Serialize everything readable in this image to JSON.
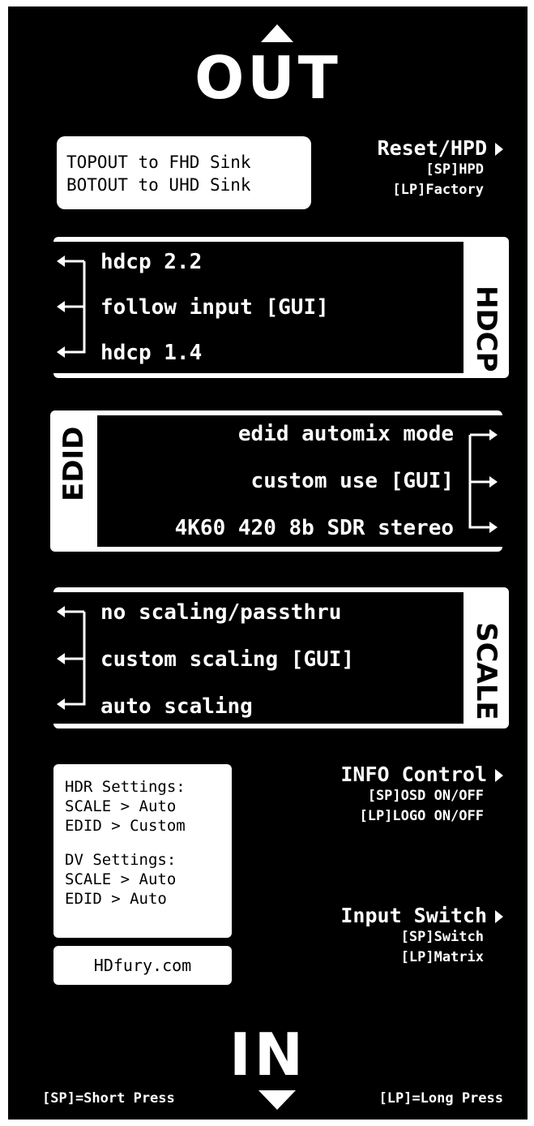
{
  "header": {
    "out_label": "OUT"
  },
  "info_box": {
    "line1": "TOPOUT to FHD Sink",
    "line2": "BOTOUT to UHD Sink"
  },
  "reset_button": {
    "label": "Reset/HPD",
    "short_press": "[SP]HPD",
    "long_press": "[LP]Factory"
  },
  "hdcp": {
    "title": "HDCP",
    "options": [
      "hdcp 2.2",
      "follow input [GUI]",
      "hdcp 1.4"
    ]
  },
  "edid": {
    "title": "EDID",
    "options": [
      "edid automix mode",
      "custom use [GUI]",
      "4K60 420 8b SDR stereo"
    ]
  },
  "scale": {
    "title": "SCALE",
    "options": [
      "no scaling/passthru",
      "custom scaling [GUI]",
      "auto scaling"
    ]
  },
  "settings_box": {
    "hdr_title": "HDR Settings:",
    "hdr_scale": "SCALE > Auto",
    "hdr_edid": "EDID > Custom",
    "dv_title": "DV Settings:",
    "dv_scale": "SCALE > Auto",
    "dv_edid": "EDID > Auto"
  },
  "website": "HDfury.com",
  "info_control": {
    "label": "INFO Control",
    "short_press": "[SP]OSD ON/OFF",
    "long_press": "[LP]LOGO ON/OFF"
  },
  "input_switch": {
    "label": "Input Switch",
    "short_press": "[SP]Switch",
    "long_press": "[LP]Matrix"
  },
  "footer": {
    "in_label": "IN",
    "sp_legend": "[SP]=Short Press",
    "lp_legend": "[LP]=Long Press"
  },
  "colors": {
    "background": "#000000",
    "foreground": "#ffffff"
  },
  "icons": [
    "arrow-up-icon",
    "arrow-down-icon",
    "arrow-right-icon",
    "left-arrow-bracket-icon",
    "right-arrow-bracket-icon"
  ]
}
